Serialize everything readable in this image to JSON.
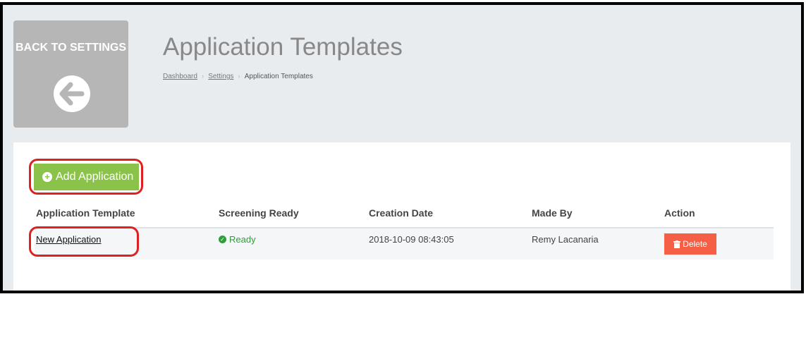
{
  "back": {
    "label": "BACK TO SETTINGS",
    "icon": "arrow-left-circle-icon"
  },
  "header": {
    "title": "Application Templates"
  },
  "breadcrumb": {
    "items": [
      "Dashboard",
      "Settings",
      "Application Templates"
    ]
  },
  "toolbar": {
    "add_label": "Add Application"
  },
  "table": {
    "columns": [
      "Application Template",
      "Screening Ready",
      "Creation Date",
      "Made By",
      "Action"
    ],
    "rows": [
      {
        "template": "New Application",
        "status": "Ready",
        "date": "2018-10-09 08:43:05",
        "made_by": "Remy Lacanaria",
        "action": "Delete"
      }
    ]
  },
  "colors": {
    "accent_green": "#8bc34a",
    "danger": "#f55f45",
    "ready": "#2e9e3a",
    "highlight": "#e02020"
  }
}
